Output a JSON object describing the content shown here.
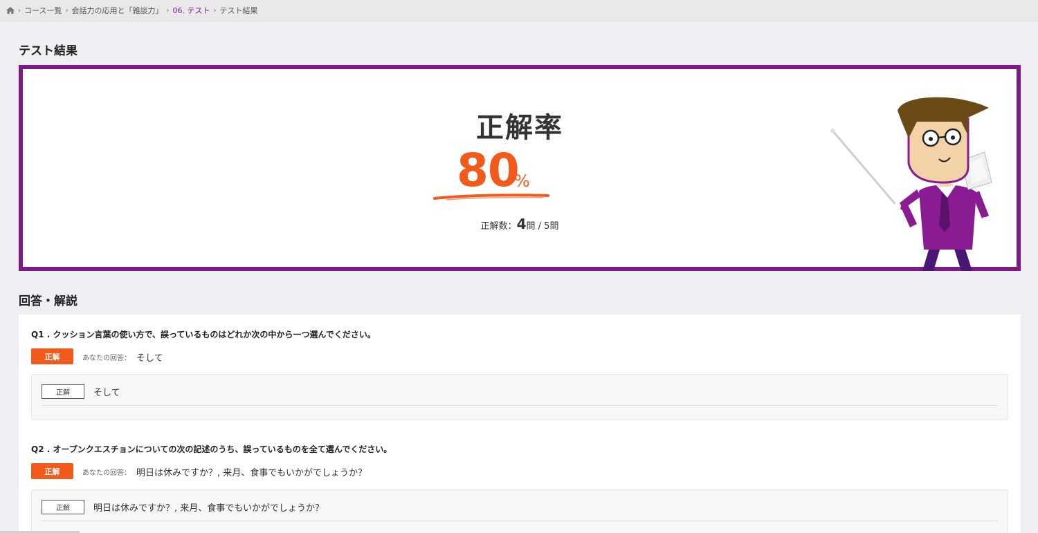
{
  "breadcrumb": {
    "items": [
      "コース一覧",
      "会話力の応用と「雑談力」",
      "06. テスト",
      "テスト結果"
    ]
  },
  "page_title": "テスト結果",
  "result": {
    "title": "正解率",
    "rate": "80",
    "unit": "%",
    "count_label": "正解数：",
    "correct": "4",
    "correct_unit": "問",
    "separator": "/",
    "total": "5問"
  },
  "section_title": "回答・解説",
  "questions": [
    {
      "text": "Q1 . クッション言葉の使い方で、誤っているものはどれか次の中から一つ選んでください。",
      "badge": "正解",
      "your_label": "あなたの回答：",
      "your_answer": "そして",
      "answer_tag": "正解",
      "answer_text": "そして"
    },
    {
      "text": "Q2 . オープンクエスチョンについての次の記述のうち、誤っているものを全て選んでください。",
      "badge": "正解",
      "your_label": "あなたの回答：",
      "your_answer": "明日は休みですか？, 来月、食事でもいかがでしょうか？",
      "answer_tag": "正解",
      "answer_text": "明日は休みですか？, 来月、食事でもいかがでしょうか？"
    }
  ],
  "colors": {
    "brand_purple": "#7b1a84",
    "accent_orange": "#f25a1c"
  }
}
